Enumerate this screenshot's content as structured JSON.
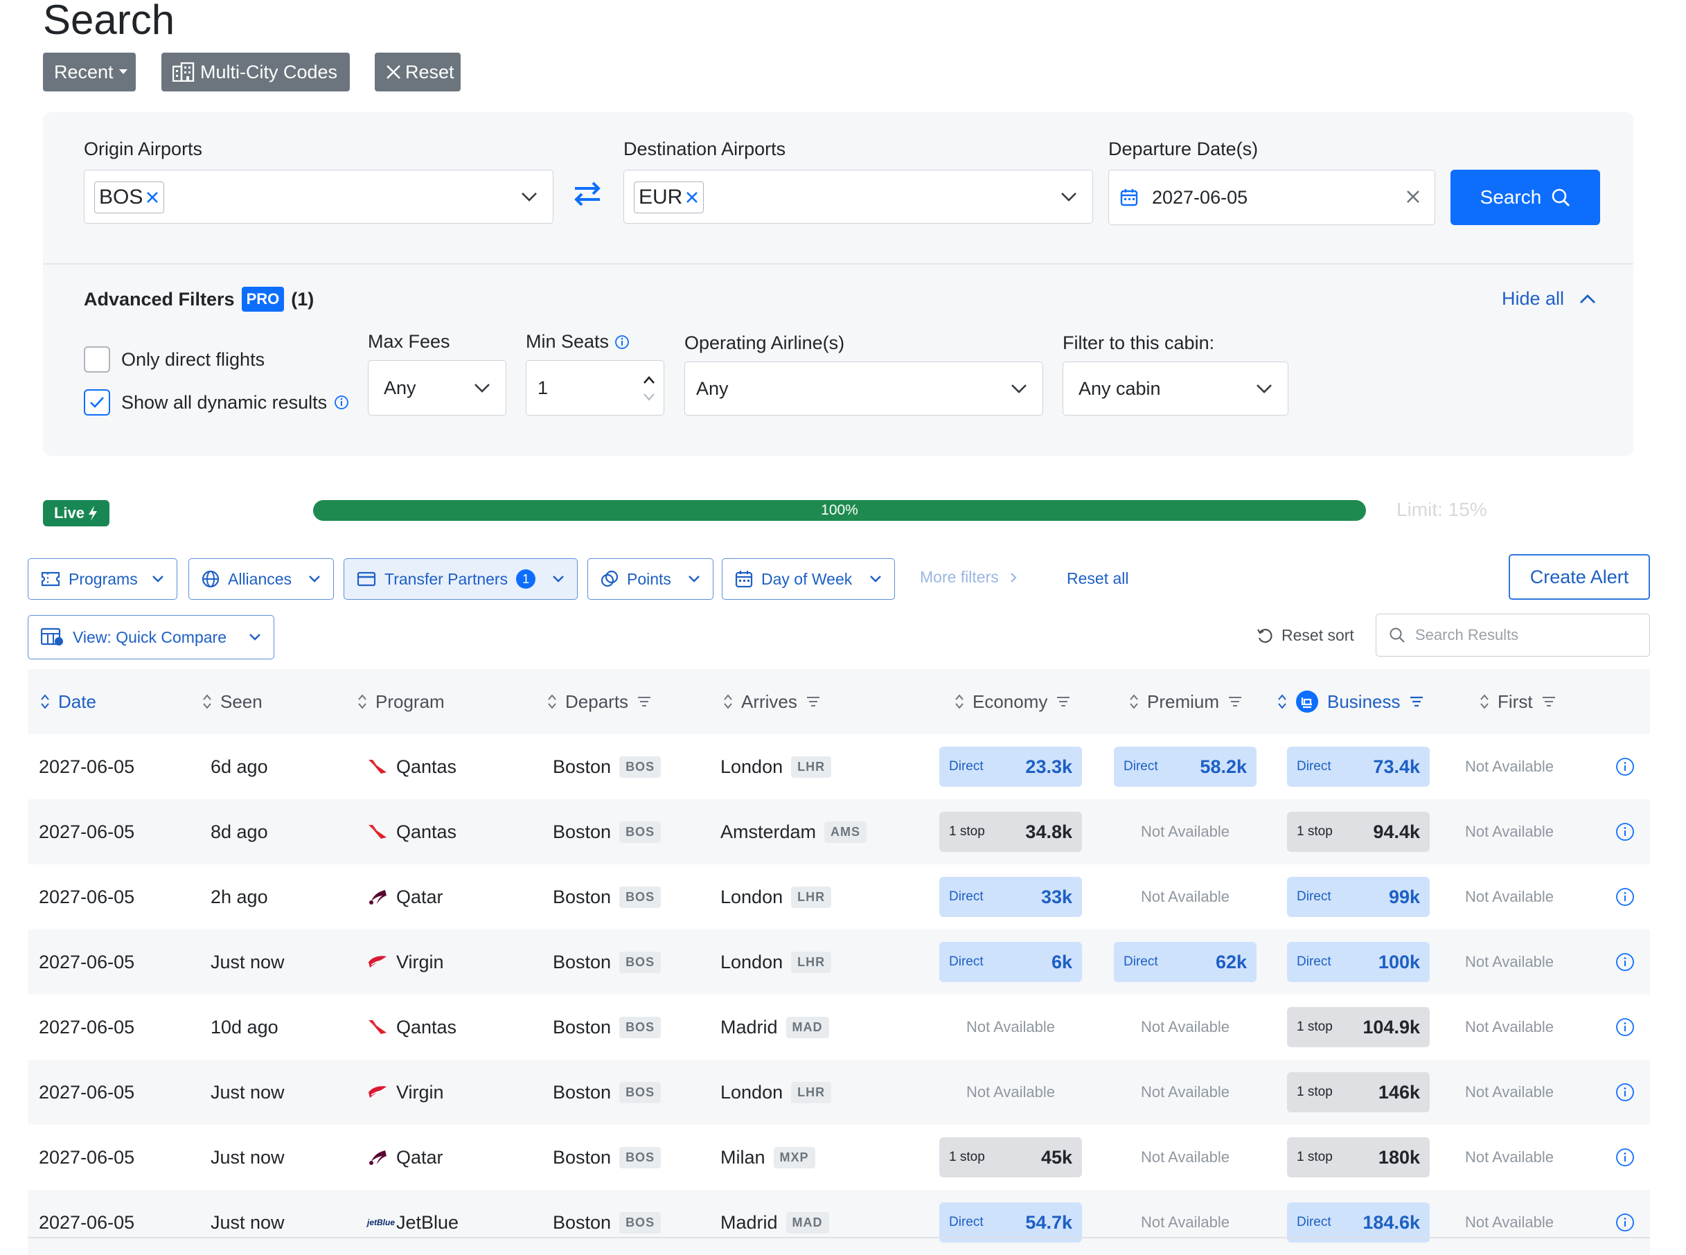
{
  "page": {
    "title": "Search"
  },
  "toolbar": {
    "recent": "Recent",
    "multi_city": "Multi-City Codes",
    "reset": "Reset"
  },
  "search": {
    "origin_label": "Origin Airports",
    "origin_chip": "BOS",
    "destination_label": "Destination Airports",
    "destination_chip": "EUR",
    "date_label": "Departure Date(s)",
    "date_value": "2027-06-05",
    "search_button": "Search"
  },
  "advanced": {
    "title": "Advanced Filters",
    "pro_badge": "PRO",
    "count": "(1)",
    "hide_all": "Hide all",
    "only_direct": "Only direct flights",
    "only_direct_checked": false,
    "show_dynamic": "Show all dynamic results",
    "show_dynamic_checked": true,
    "max_fees_label": "Max Fees",
    "max_fees_value": "Any",
    "min_seats_label": "Min Seats",
    "min_seats_value": "1",
    "airline_label": "Operating Airline(s)",
    "airline_value": "Any",
    "cabin_label": "Filter to this cabin:",
    "cabin_value": "Any cabin"
  },
  "progress": {
    "live": "Live",
    "percent": 100,
    "percent_label": "100%",
    "limit": "Limit: 15%"
  },
  "filters": {
    "programs": "Programs",
    "alliances": "Alliances",
    "transfer_partners": "Transfer Partners",
    "transfer_partners_count": "1",
    "points": "Points",
    "day_of_week": "Day of Week",
    "more_filters": "More filters",
    "reset_all": "Reset all",
    "create_alert": "Create Alert",
    "view": "View: Quick Compare",
    "reset_sort": "Reset sort",
    "search_placeholder": "Search Results"
  },
  "table": {
    "headers": {
      "date": "Date",
      "seen": "Seen",
      "program": "Program",
      "departs": "Departs",
      "arrives": "Arrives",
      "economy": "Economy",
      "premium": "Premium",
      "business": "Business",
      "first": "First"
    },
    "not_available": "Not Available",
    "rows": [
      {
        "date": "2027-06-05",
        "seen": "6d ago",
        "program": "Qantas",
        "logo": "qantas",
        "from": "Boston",
        "from_code": "BOS",
        "to": "London",
        "to_code": "LHR",
        "economy": {
          "type": "Direct",
          "value": "23.3k"
        },
        "premium": {
          "type": "Direct",
          "value": "58.2k"
        },
        "business": {
          "type": "Direct",
          "value": "73.4k"
        },
        "first": null
      },
      {
        "date": "2027-06-05",
        "seen": "8d ago",
        "program": "Qantas",
        "logo": "qantas",
        "from": "Boston",
        "from_code": "BOS",
        "to": "Amsterdam",
        "to_code": "AMS",
        "economy": {
          "type": "1 stop",
          "value": "34.8k"
        },
        "premium": null,
        "business": {
          "type": "1 stop",
          "value": "94.4k"
        },
        "first": null
      },
      {
        "date": "2027-06-05",
        "seen": "2h ago",
        "program": "Qatar",
        "logo": "qatar",
        "from": "Boston",
        "from_code": "BOS",
        "to": "London",
        "to_code": "LHR",
        "economy": {
          "type": "Direct",
          "value": "33k"
        },
        "premium": null,
        "business": {
          "type": "Direct",
          "value": "99k"
        },
        "first": null
      },
      {
        "date": "2027-06-05",
        "seen": "Just now",
        "program": "Virgin",
        "logo": "virgin",
        "from": "Boston",
        "from_code": "BOS",
        "to": "London",
        "to_code": "LHR",
        "economy": {
          "type": "Direct",
          "value": "6k"
        },
        "premium": {
          "type": "Direct",
          "value": "62k"
        },
        "business": {
          "type": "Direct",
          "value": "100k"
        },
        "first": null
      },
      {
        "date": "2027-06-05",
        "seen": "10d ago",
        "program": "Qantas",
        "logo": "qantas",
        "from": "Boston",
        "from_code": "BOS",
        "to": "Madrid",
        "to_code": "MAD",
        "economy": null,
        "premium": null,
        "business": {
          "type": "1 stop",
          "value": "104.9k"
        },
        "first": null
      },
      {
        "date": "2027-06-05",
        "seen": "Just now",
        "program": "Virgin",
        "logo": "virgin",
        "from": "Boston",
        "from_code": "BOS",
        "to": "London",
        "to_code": "LHR",
        "economy": null,
        "premium": null,
        "business": {
          "type": "1 stop",
          "value": "146k"
        },
        "first": null
      },
      {
        "date": "2027-06-05",
        "seen": "Just now",
        "program": "Qatar",
        "logo": "qatar",
        "from": "Boston",
        "from_code": "BOS",
        "to": "Milan",
        "to_code": "MXP",
        "economy": {
          "type": "1 stop",
          "value": "45k"
        },
        "premium": null,
        "business": {
          "type": "1 stop",
          "value": "180k"
        },
        "first": null
      },
      {
        "date": "2027-06-05",
        "seen": "Just now",
        "program": "JetBlue",
        "logo": "jetblue",
        "logo_text": "jetBlue",
        "from": "Boston",
        "from_code": "BOS",
        "to": "Madrid",
        "to_code": "MAD",
        "economy": {
          "type": "Direct",
          "value": "54.7k"
        },
        "premium": null,
        "business": {
          "type": "Direct",
          "value": "184.6k"
        },
        "first": null
      }
    ]
  },
  "colors": {
    "accent": "#0d6efd",
    "direct_bg": "#cfe2fc",
    "stop_bg": "#dee0e3",
    "live": "#198754"
  }
}
